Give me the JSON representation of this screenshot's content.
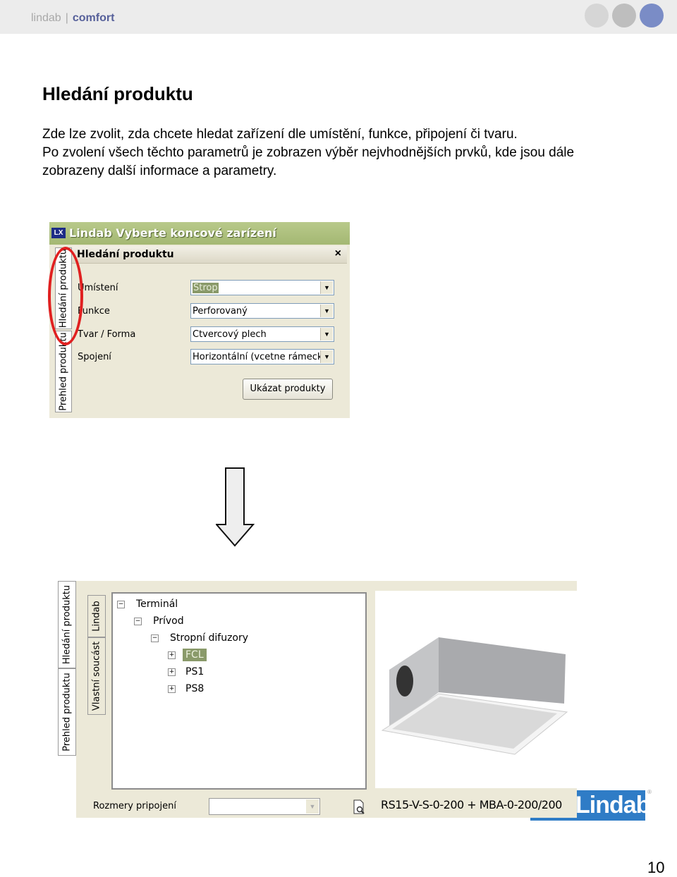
{
  "header": {
    "brand_left": "lindab",
    "brand_sep": "|",
    "brand_right": "comfort",
    "dot_colors": [
      "#d6d6d6",
      "#bebebe",
      "#7a8cc6"
    ]
  },
  "page": {
    "title": "Hledání produktu",
    "paragraph1": "Zde lze zvolit, zda chcete hledat zařízení dle umístění, funkce, připojení či tvaru.",
    "paragraph2": "Po zvolení všech těchto parametrů je zobrazen výběr nejvhodnějších prvků, kde jsou dále zobrazeny další informace a parametry.",
    "page_number": "10"
  },
  "dialog1": {
    "app_icon": "LX",
    "window_title": "Lindab Vyberte koncové zarízení",
    "side_tabs": [
      "Hledání produktu",
      "Prehled produktu"
    ],
    "panel_title": "Hledání produktu",
    "close_icon": "×",
    "fields": [
      {
        "label": "Umístení",
        "value": "Strop",
        "selected": true
      },
      {
        "label": "Funkce",
        "value": "Perforovaný"
      },
      {
        "label": "Tvar / Forma",
        "value": "Ctvercový plech"
      },
      {
        "label": "Spojení",
        "value": "Horizontální (vcetne rámecku)"
      }
    ],
    "button_label": "Ukázat produkty",
    "highlight_color": "#e02020"
  },
  "dialog2": {
    "side_tabs": [
      "Hledání produktu",
      "Prehled produktu"
    ],
    "inner_tabs": [
      "Lindab",
      "Vlastní soucást"
    ],
    "tree": [
      {
        "label": "Terminál",
        "expander": "−",
        "level": 0
      },
      {
        "label": "Prívod",
        "expander": "−",
        "level": 1
      },
      {
        "label": "Stropní difuzory",
        "expander": "−",
        "level": 2
      },
      {
        "label": "FCL",
        "expander": "+",
        "level": 3,
        "selected": true
      },
      {
        "label": "PS1",
        "expander": "+",
        "level": 3
      },
      {
        "label": "PS8",
        "expander": "+",
        "level": 3
      }
    ],
    "bottom_label": "Rozmery pripojení",
    "bottom_combo_value": "",
    "product_code": "RS15-V-S-0-200 + MBA-0-200/200",
    "image_alt": "ceiling diffuser product photo"
  },
  "logo": {
    "text": "Lindab",
    "reg": "®",
    "color": "#2f7cc6"
  }
}
